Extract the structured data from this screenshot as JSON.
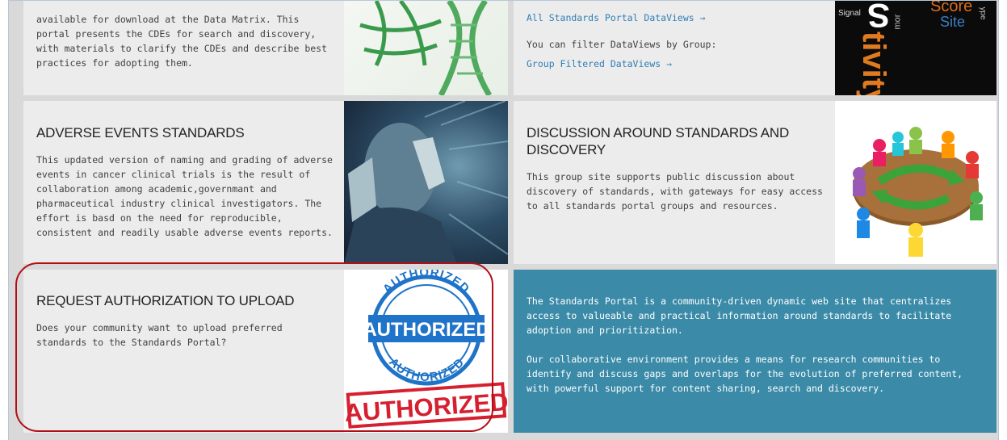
{
  "top_left": {
    "text": "available for download at the Data Matrix. This portal presents the CDEs for search and discovery, with materials to clarify the CDEs and describe best practices for adopting them."
  },
  "top_right": {
    "link_all": "All Standards Portal DataViews →",
    "filter_text": "You can filter DataViews by Group:",
    "link_group": "Group Filtered DataViews →",
    "image_words": [
      "Signal",
      "S",
      "tivity",
      "Score",
      "Site",
      "ype",
      "mor"
    ]
  },
  "adverse": {
    "title": "ADVERSE EVENTS STANDARDS",
    "text": "This updated version of naming and grading of adverse events in cancer clinical trials is the result of collaboration among academic,governmant and pharmaceutical industry clinical investigators. The effort is basd on the need for reproducible, consistent and readily usable adverse events reports."
  },
  "discussion": {
    "title": "DISCUSSION AROUND STANDARDS AND DISCOVERY",
    "text": "This group site supports public discussion about discovery of standards, with gateways for easy access to all standards portal groups and resources."
  },
  "request": {
    "title": "REQUEST AUTHORIZATION TO UPLOAD",
    "text": "Does your community want to upload preferred standards to the Standards Portal?",
    "stamp_arc_top": "AUTHORIZED",
    "stamp_main": "AUTHORIZED",
    "stamp_arc_bottom": "AUTHORIZED",
    "stamp_red": "AUTHORIZED"
  },
  "about": {
    "p1": "The Standards Portal is a community-driven dynamic web site that centralizes access to valueable and practical information around standards to facilitate adoption and prioritization.",
    "p2": "Our collaborative environment provides a means for research communities to identify and discuss gaps and overlaps for the evolution of preferred content, with powerful support for content sharing, search and discovery."
  },
  "colors": {
    "link": "#2f7fb6",
    "blue_panel": "#3a8aa8",
    "highlight_red": "#b20e16"
  }
}
